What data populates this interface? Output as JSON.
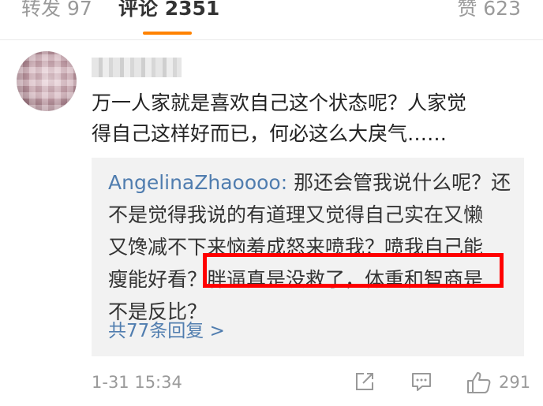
{
  "tabs": {
    "repost": "转发 97",
    "comment": "评论 2351",
    "like": "赞 623"
  },
  "comment": {
    "lines": [
      "万一人家就是喜欢自己这个状态呢？人家觉",
      "得自己这样好而已，何必这么大戾气……"
    ],
    "timestamp": "1-31 15:34",
    "like_count": "291"
  },
  "reply": {
    "author": "AngelinaZhaoooo:",
    "line1_rest": " 那还会管我说什么呢？还",
    "lines": [
      "不是觉得我说的有道理又觉得自己实在又懒",
      "又馋减不下来恼羞成怒来喷我？喷我自己能",
      "瘦能好看？胖逼真是没救了，体重和智商是",
      "不是反比？"
    ],
    "more_replies": "共77条回复 >"
  },
  "colors": {
    "accent": "#ff8200",
    "link": "#507daf",
    "highlight_border": "#ff0000",
    "reply_bg": "#f2f2f2"
  },
  "icons": {
    "share": "share-icon",
    "reply": "reply-icon",
    "like": "thumbs-up-icon"
  }
}
